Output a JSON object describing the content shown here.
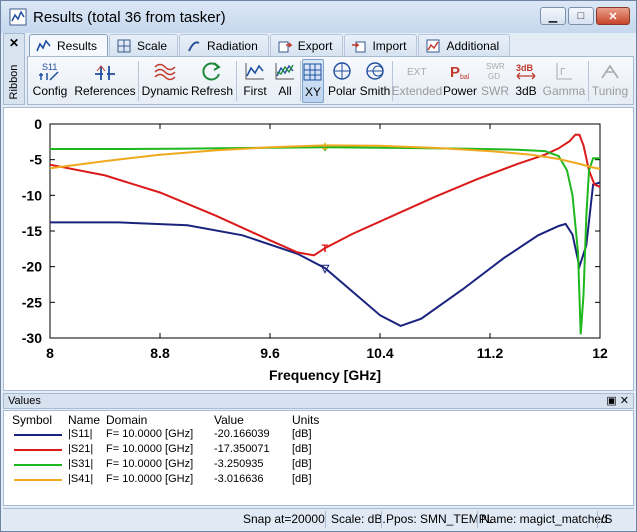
{
  "window": {
    "title": "Results (total 36 from tasker)"
  },
  "ribbon_side": {
    "close": "✕",
    "label": "Ribbon"
  },
  "tabs": [
    {
      "label": "Results"
    },
    {
      "label": "Scale"
    },
    {
      "label": "Radiation"
    },
    {
      "label": "Export"
    },
    {
      "label": "Import"
    },
    {
      "label": "Additional"
    }
  ],
  "ribbon": {
    "config": "Config",
    "references": "References",
    "dynamic": "Dynamic",
    "refresh": "Refresh",
    "first": "First",
    "all": "All",
    "xy": "XY",
    "polar": "Polar",
    "smith": "Smith",
    "extended": "Extended",
    "power": "Power",
    "swr": "SWR",
    "three_db": "3dB",
    "gamma": "Gamma",
    "tuning": "Tuning",
    "icon_s11": "S11",
    "icon_ext": "EXT",
    "icon_pbal": "P",
    "icon_pbal_sub": "bal",
    "icon_swr": "SWR",
    "icon_gd": "GD",
    "icon_3db": "3dB",
    "icon_gamma": "Γ"
  },
  "chart_data": {
    "type": "line",
    "xlabel": "Frequency [GHz]",
    "ylabel": "",
    "xlim": [
      8,
      12
    ],
    "ylim": [
      -30,
      0
    ],
    "x_ticks": [
      "8",
      "8.8",
      "9.6",
      "10.4",
      "11.2",
      "12"
    ],
    "y_ticks": [
      "0",
      "-5",
      "-10",
      "-15",
      "-20",
      "-25",
      "-30"
    ],
    "grid": false,
    "series": [
      {
        "name": "|S11|",
        "color": "#1a237e",
        "marker": "▽",
        "x": [
          8,
          8.5,
          9.0,
          9.4,
          9.8,
          10.0,
          10.2,
          10.4,
          10.55,
          10.7,
          11.0,
          11.3,
          11.55,
          11.7,
          11.75,
          11.8,
          11.85,
          11.9,
          11.95,
          12.0
        ],
        "y": [
          -13.8,
          -13.8,
          -14.2,
          -15.6,
          -18.2,
          -20.2,
          -23.5,
          -26.8,
          -28.3,
          -27.3,
          -23.2,
          -18.8,
          -15.6,
          -14.3,
          -14.0,
          -15.5,
          -20.0,
          -17.0,
          -8.5,
          -8.2
        ]
      },
      {
        "name": "|S21|",
        "color": "#dc1a1a",
        "marker": "T",
        "x": [
          8,
          8.4,
          8.8,
          9.2,
          9.6,
          9.8,
          9.92,
          10.0,
          10.2,
          10.5,
          10.8,
          11.1,
          11.4,
          11.6,
          11.7,
          11.78,
          11.82,
          11.85,
          11.88,
          11.92,
          11.96,
          12.0
        ],
        "y": [
          -5.7,
          -7.2,
          -9.6,
          -12.8,
          -16.3,
          -18.0,
          -18.4,
          -17.4,
          -15.4,
          -12.8,
          -10.2,
          -7.8,
          -5.6,
          -4.3,
          -3.4,
          -2.4,
          -1.5,
          -1.5,
          -3.0,
          -6.5,
          -8.5,
          -8.8
        ]
      },
      {
        "name": "|S31|",
        "color": "#1eb81e",
        "marker": "I",
        "x": [
          8,
          8.5,
          9.0,
          9.5,
          10.0,
          10.5,
          11.0,
          11.4,
          11.6,
          11.7,
          11.76,
          11.8,
          11.84,
          11.86,
          11.88,
          11.9,
          11.92,
          11.95,
          12.0
        ],
        "y": [
          -3.5,
          -3.5,
          -3.45,
          -3.35,
          -3.25,
          -3.35,
          -3.45,
          -3.6,
          -3.8,
          -4.5,
          -6.5,
          -10,
          -18,
          -29.5,
          -24,
          -13,
          -6.5,
          -4.8,
          -4.8
        ]
      },
      {
        "name": "|S41|",
        "color": "#f0a81e",
        "marker": "±",
        "x": [
          8,
          8.4,
          8.8,
          9.2,
          9.6,
          10.0,
          10.4,
          10.8,
          11.2,
          11.5,
          11.7,
          11.85,
          11.95,
          12.0
        ],
        "y": [
          -6.2,
          -5.2,
          -4.3,
          -3.7,
          -3.25,
          -3.0,
          -3.05,
          -3.35,
          -3.8,
          -4.3,
          -4.9,
          -5.6,
          -6.1,
          -6.3
        ]
      }
    ]
  },
  "values_panel": {
    "title": "Values",
    "headers": [
      "Symbol",
      "Name",
      "Domain",
      "Value",
      "Units"
    ],
    "rows": [
      {
        "name": "|S11|",
        "domain": "F= 10.0000 [GHz]",
        "value": "-20.166039",
        "units": "[dB]",
        "color": "#1a237e"
      },
      {
        "name": "|S21|",
        "domain": "F= 10.0000 [GHz]",
        "value": "-17.350071",
        "units": "[dB]",
        "color": "#dc1a1a"
      },
      {
        "name": "|S31|",
        "domain": "F= 10.0000 [GHz]",
        "value": "-3.250935",
        "units": "[dB]",
        "color": "#1eb81e"
      },
      {
        "name": "|S41|",
        "domain": "F= 10.0000 [GHz]",
        "value": "-3.016636",
        "units": "[dB]",
        "color": "#f0a81e"
      }
    ]
  },
  "status": {
    "snap": "Snap at=20000",
    "scale": "Scale: dB.",
    "ppos": "Ppos: SMN_TEMPL",
    "name": "Name: magict_matched",
    "tail": "/S"
  }
}
